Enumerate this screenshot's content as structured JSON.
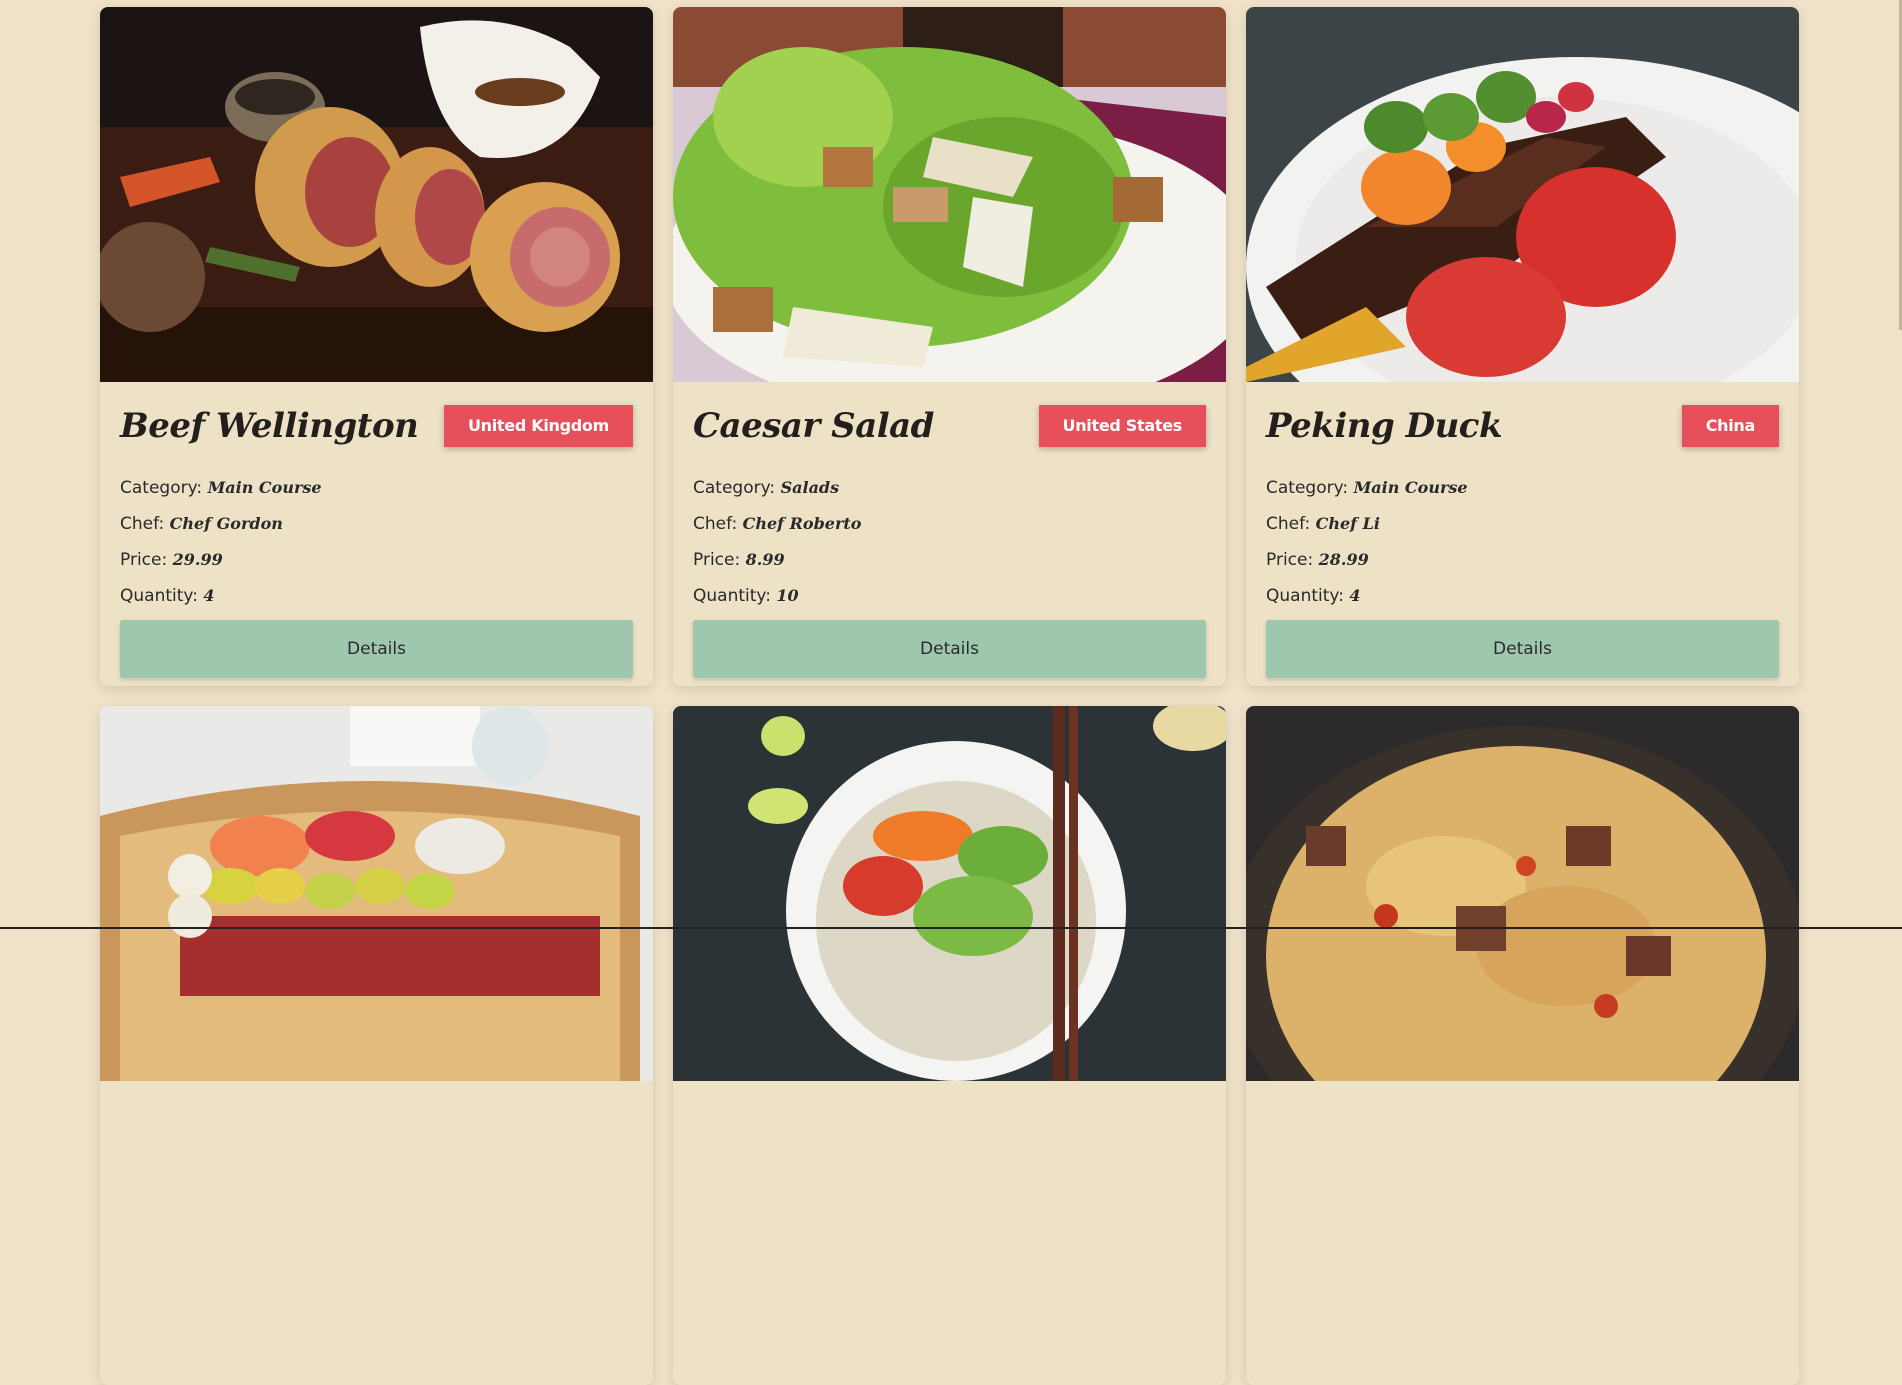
{
  "cards": [
    {
      "title": "Beef Wellington",
      "country": "United Kingdom",
      "category_label": "Category:",
      "category": "Main Course",
      "chef_label": "Chef:",
      "chef": "Chef Gordon",
      "price_label": "Price:",
      "price": "29.99",
      "qty_label": "Quantity:",
      "qty": "4",
      "button": "Details",
      "image": "beef-wellington-photo"
    },
    {
      "title": "Caesar Salad",
      "country": "United States",
      "category_label": "Category:",
      "category": "Salads",
      "chef_label": "Chef:",
      "chef": "Chef Roberto",
      "price_label": "Price:",
      "price": "8.99",
      "qty_label": "Quantity:",
      "qty": "10",
      "button": "Details",
      "image": "caesar-salad-photo"
    },
    {
      "title": "Peking Duck",
      "country": "China",
      "category_label": "Category:",
      "category": "Main Course",
      "chef_label": "Chef:",
      "chef": "Chef Li",
      "price_label": "Price:",
      "price": "28.99",
      "qty_label": "Quantity:",
      "qty": "4",
      "button": "Details",
      "image": "peking-duck-photo"
    },
    {
      "image": "sushi-boat-photo"
    },
    {
      "image": "noodle-bowl-photo"
    },
    {
      "image": "beef-pasta-photo"
    }
  ],
  "colors": {
    "background": "#efe2c8",
    "badge": "#e7505a",
    "button": "#9dc8ad"
  }
}
